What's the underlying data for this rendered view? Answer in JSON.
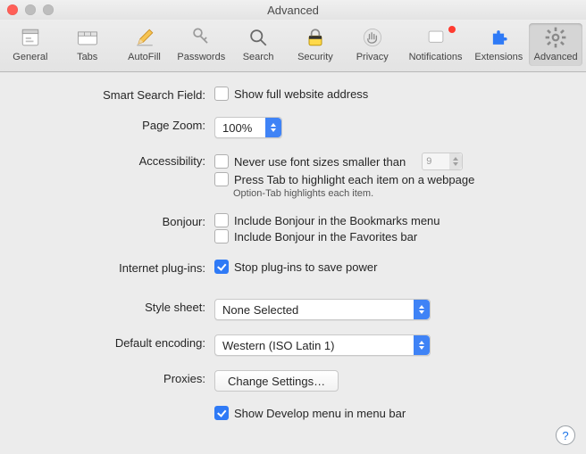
{
  "window": {
    "title": "Advanced"
  },
  "toolbar": {
    "items": [
      {
        "label": "General"
      },
      {
        "label": "Tabs"
      },
      {
        "label": "AutoFill"
      },
      {
        "label": "Passwords"
      },
      {
        "label": "Search"
      },
      {
        "label": "Security"
      },
      {
        "label": "Privacy"
      },
      {
        "label": "Notifications"
      },
      {
        "label": "Extensions"
      },
      {
        "label": "Advanced"
      }
    ],
    "selected": 9
  },
  "labels": {
    "smart_search": "Smart Search Field:",
    "page_zoom": "Page Zoom:",
    "accessibility": "Accessibility:",
    "bonjour": "Bonjour:",
    "plugins": "Internet plug-ins:",
    "style_sheet": "Style sheet:",
    "default_encoding": "Default encoding:",
    "proxies": "Proxies:"
  },
  "smart_search": {
    "show_full_url": "Show full website address",
    "checked": false
  },
  "page_zoom": {
    "value": "100%"
  },
  "accessibility": {
    "font_size_label": "Never use font sizes smaller than",
    "font_size_value": "9",
    "font_size_checked": false,
    "tab_highlight": "Press Tab to highlight each item on a webpage",
    "tab_highlight_checked": false,
    "hint": "Option-Tab highlights each item."
  },
  "bonjour": {
    "bookmarks": "Include Bonjour in the Bookmarks menu",
    "bookmarks_checked": false,
    "favorites": "Include Bonjour in the Favorites bar",
    "favorites_checked": false
  },
  "plugins": {
    "stop_to_save": "Stop plug-ins to save power",
    "checked": true
  },
  "style_sheet": {
    "value": "None Selected"
  },
  "default_encoding": {
    "value": "Western (ISO Latin 1)"
  },
  "proxies": {
    "button": "Change Settings…"
  },
  "develop_menu": {
    "label": "Show Develop menu in menu bar",
    "checked": true
  },
  "help": "?"
}
